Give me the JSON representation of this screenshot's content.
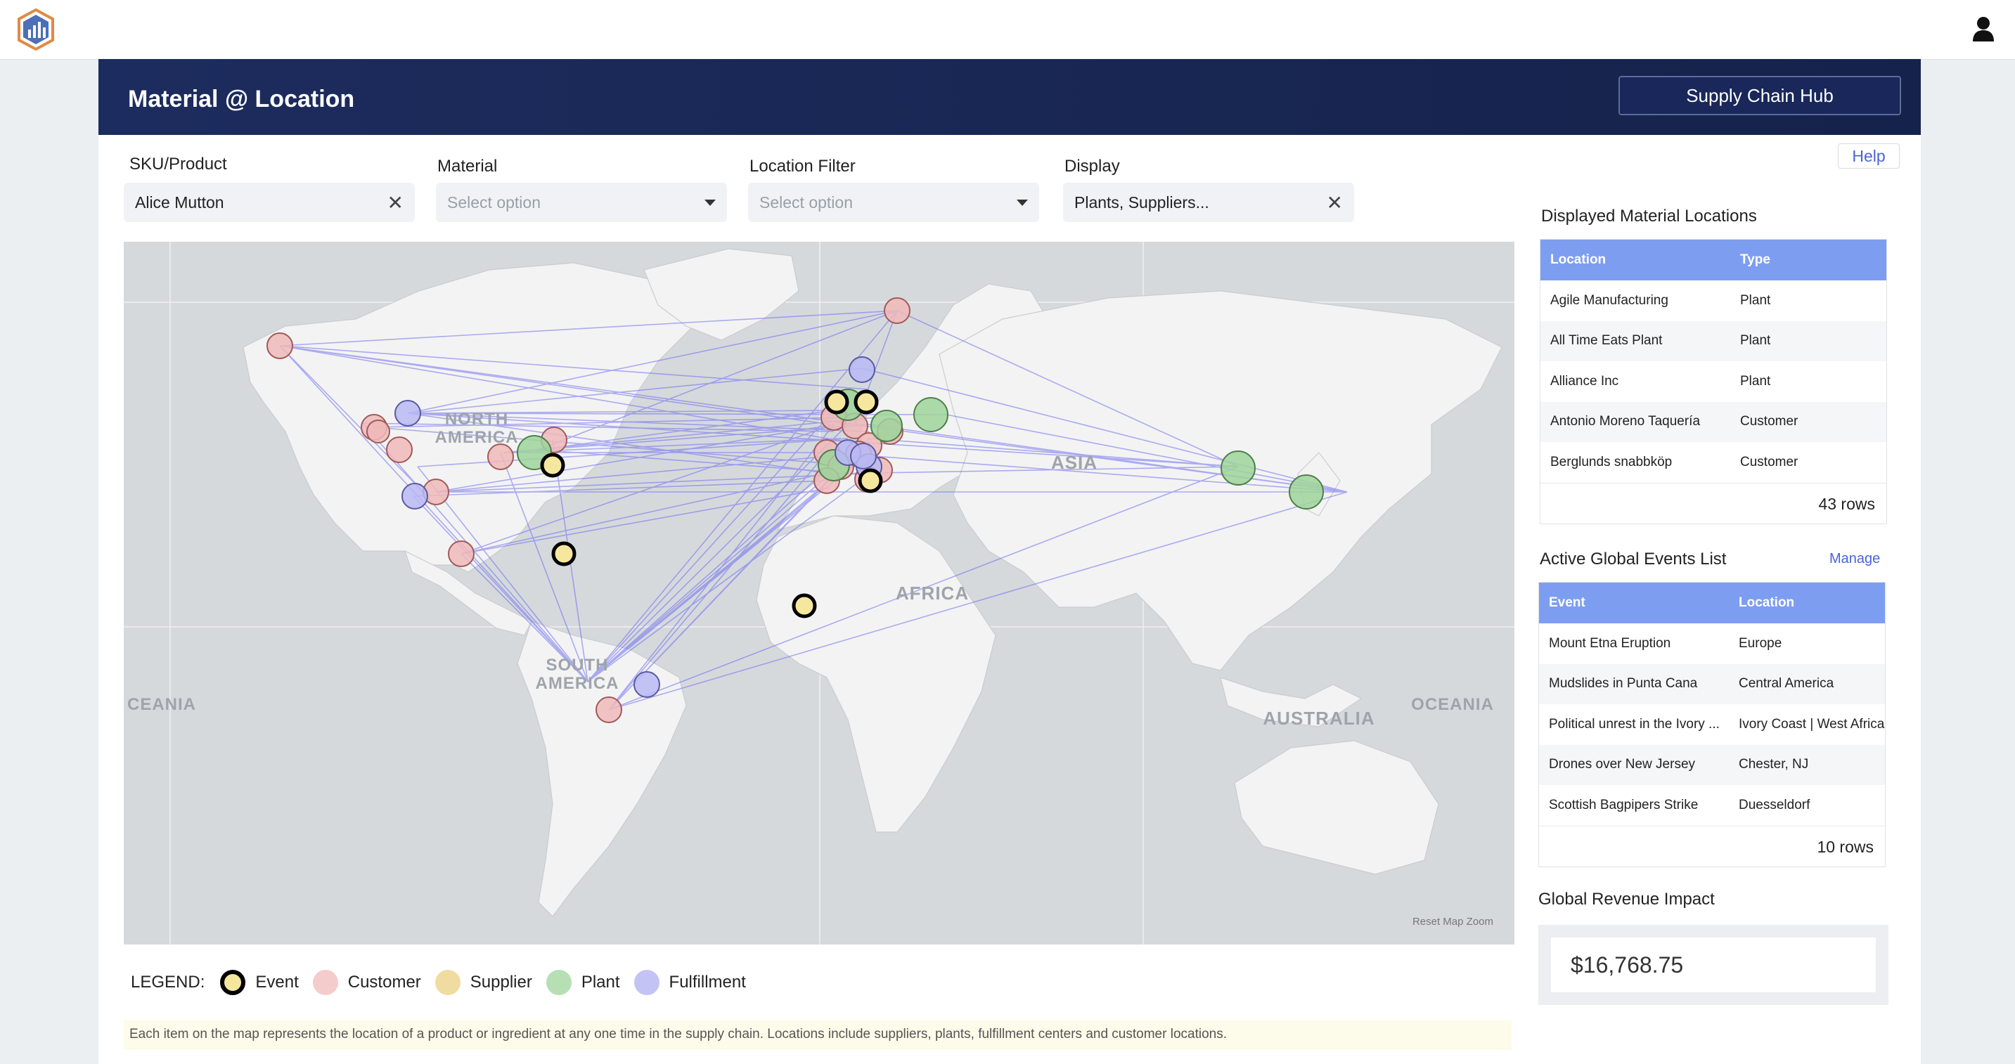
{
  "header": {
    "title": "Material @ Location",
    "hub_button": "Supply Chain Hub"
  },
  "filters": {
    "sku": {
      "label": "SKU/Product",
      "value": "Alice Mutton"
    },
    "material": {
      "label": "Material",
      "placeholder": "Select option"
    },
    "location": {
      "label": "Location Filter",
      "placeholder": "Select option"
    },
    "display": {
      "label": "Display",
      "value": "Plants, Suppliers..."
    }
  },
  "help_label": "Help",
  "map": {
    "regions": [
      "NORTH AMERICA",
      "SOUTH AMERICA",
      "AFRICA",
      "ASIA",
      "AUSTRALIA",
      "OCEANIA",
      "CEANIA"
    ],
    "reset_zoom": "Reset Map Zoom"
  },
  "legend": {
    "label": "LEGEND:",
    "items": [
      {
        "name": "Event",
        "color": "#f5e79e",
        "border": "#000000"
      },
      {
        "name": "Customer",
        "color": "#f4cccc",
        "border": "#f4cccc"
      },
      {
        "name": "Supplier",
        "color": "#f0dca0",
        "border": "#f0dca0"
      },
      {
        "name": "Plant",
        "color": "#b6dfb4",
        "border": "#b6dfb4"
      },
      {
        "name": "Fulfillment",
        "color": "#c3c3f5",
        "border": "#c3c3f5"
      }
    ]
  },
  "note": "Each item on the map represents the location of a product or ingredient at any one time in the supply chain. Locations include suppliers, plants, fulfillment centers and customer locations.",
  "locations_panel": {
    "title": "Displayed Material Locations",
    "columns": [
      "Location",
      "Type"
    ],
    "rows": [
      [
        "Agile Manufacturing",
        "Plant"
      ],
      [
        "All Time Eats Plant",
        "Plant"
      ],
      [
        "Alliance Inc",
        "Plant"
      ],
      [
        "Antonio Moreno Taquería",
        "Customer"
      ],
      [
        "Berglunds snabbköp",
        "Customer"
      ]
    ],
    "row_count": "43 rows"
  },
  "events_panel": {
    "title": "Active Global Events List",
    "manage": "Manage",
    "columns": [
      "Event",
      "Location"
    ],
    "rows": [
      [
        "Mount Etna Eruption",
        "Europe"
      ],
      [
        "Mudslides in Punta Cana",
        "Central America"
      ],
      [
        "Political unrest in the Ivory ...",
        "Ivory Coast | West Africa"
      ],
      [
        "Drones over New Jersey",
        "Chester, NJ"
      ],
      [
        "Scottish Bagpipers Strike",
        "Duesseldorf"
      ]
    ],
    "row_count": "10 rows"
  },
  "revenue": {
    "title": "Global Revenue Impact",
    "value": "$16,768.75"
  },
  "colors": {
    "header_bg": "#1b2a5a",
    "accent": "#7d9ef0",
    "route_line": "#6f6ff0"
  }
}
